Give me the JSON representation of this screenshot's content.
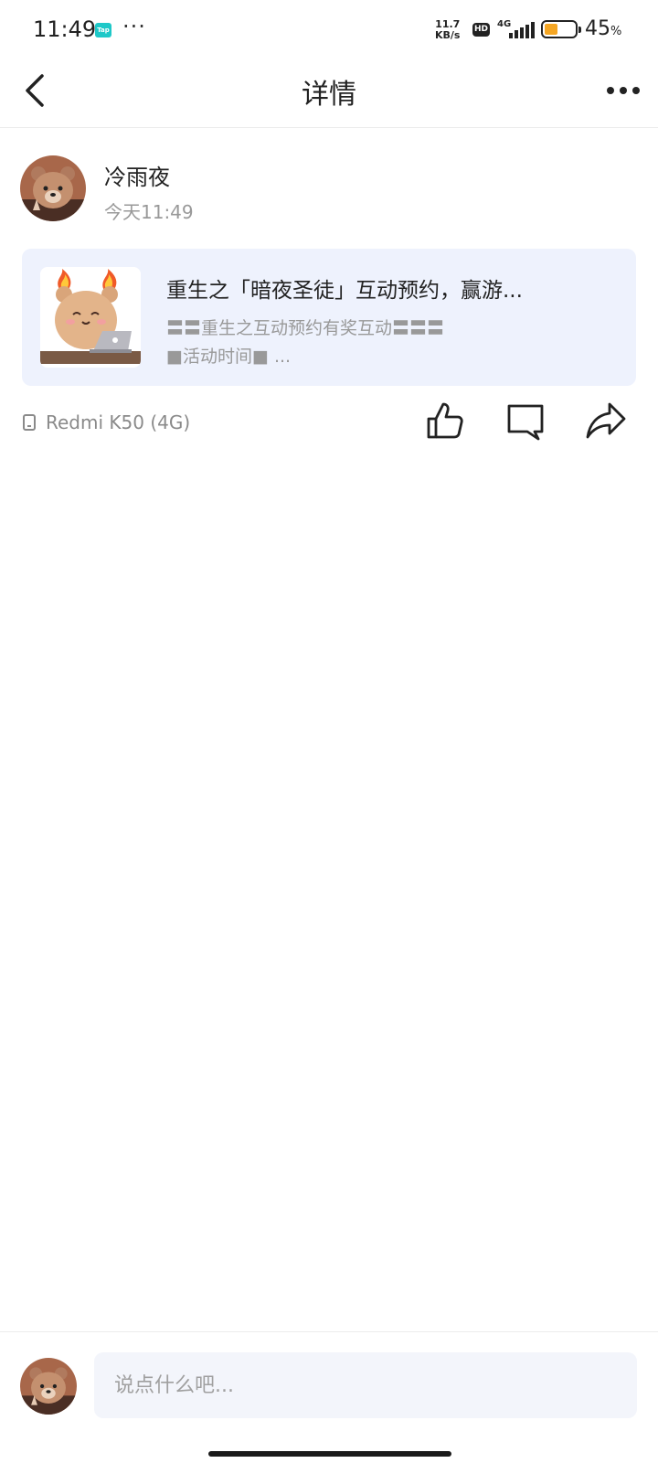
{
  "status_bar": {
    "time": "11:49",
    "app_badge": "Tap",
    "dots": "···",
    "speed_value": "11.7",
    "speed_unit": "KB/s",
    "hd_badge": "HD",
    "network": "4G",
    "battery_percent": "45",
    "battery_unit": "%",
    "battery_level": 0.45
  },
  "header": {
    "title": "详情",
    "back_icon": "chevron-left-icon",
    "more_icon": "more-horizontal-icon"
  },
  "post": {
    "author": "冷雨夜",
    "time": "今天11:49",
    "card": {
      "title": "重生之「暗夜圣徒」互动预约，赢游...",
      "desc_line1": "〓〓重生之互动预约有奖互动〓〓〓",
      "desc_line2": "■活动时间■ ..."
    },
    "device": "Redmi K50 (4G)",
    "actions": {
      "like_icon": "thumbs-up-icon",
      "comment_icon": "comment-icon",
      "share_icon": "share-icon"
    }
  },
  "comment_bar": {
    "placeholder": "说点什么吧..."
  },
  "colors": {
    "card_bg": "#eef2fd",
    "battery": "#f5a623",
    "muted_text": "#999999",
    "input_bg": "#f3f5fb"
  }
}
